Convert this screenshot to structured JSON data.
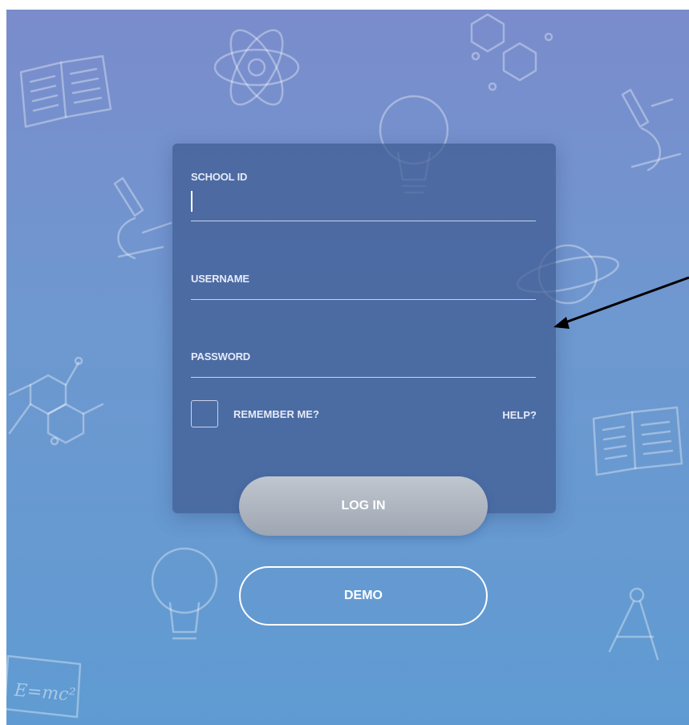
{
  "form": {
    "school_id_label": "SCHOOL ID",
    "school_id_value": "",
    "username_label": "USERNAME",
    "username_value": "",
    "password_label": "PASSWORD",
    "password_value": "",
    "remember_label": "REMEMBER ME?",
    "remember_checked": false,
    "help_label": "HELP?"
  },
  "buttons": {
    "login_label": "LOG IN",
    "demo_label": "DEMO"
  },
  "background": {
    "equation_text": "E=mc²",
    "decorations": [
      "book-icon",
      "atom-icon",
      "molecule-icon",
      "lightbulb-icon",
      "microscope-icon",
      "planet-icon",
      "compass-icon",
      "chalkboard-icon"
    ]
  },
  "colors": {
    "bg_top": "#7a8ccc",
    "bg_bottom": "#5f9bd2",
    "card": "#3e5a91",
    "login_button": "#aab1bc",
    "annotation_arrow": "#000000"
  }
}
